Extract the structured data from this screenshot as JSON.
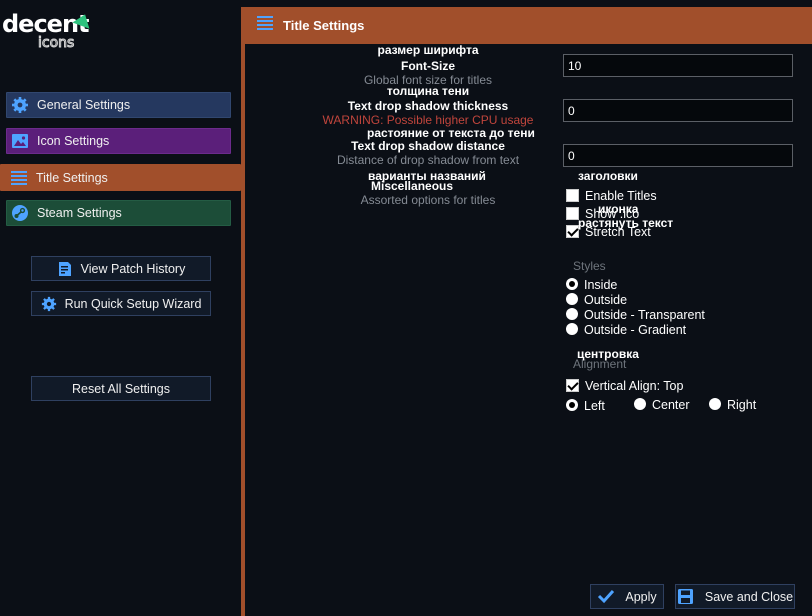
{
  "logo": {
    "line1": "decent",
    "line2": "icons"
  },
  "sidebar": {
    "items": [
      {
        "label": "General Settings",
        "icon": "gear-icon",
        "color": "#25385f"
      },
      {
        "label": "Icon Settings",
        "icon": "image-icon",
        "color": "#5b1f7a"
      },
      {
        "label": "Title Settings",
        "icon": "lines-icon",
        "color": "#a14f2b"
      },
      {
        "label": "Steam Settings",
        "icon": "steam-icon",
        "color": "#1c4d38"
      }
    ],
    "buttons": {
      "history": "View Patch History",
      "wizard": "Run Quick Setup Wizard",
      "reset": "Reset All Settings"
    }
  },
  "header": {
    "title": "Title Settings",
    "accent": "#a14f2b"
  },
  "settings": {
    "font_size": {
      "ru_label": "размер ширифта",
      "label": "Font-Size",
      "desc": "Global font size for titles",
      "value": "10"
    },
    "shadow_thickness": {
      "ru_label": "толщина тени",
      "label": "Text drop shadow thickness",
      "warning": "WARNING: Possible higher CPU usage",
      "value": "0"
    },
    "shadow_distance": {
      "ru_label": "растояние от текста до тени",
      "label": "Text drop shadow distance",
      "desc": "Distance of drop shadow from text",
      "value": "0"
    },
    "misc": {
      "ru_label": "варианты названий",
      "label": "Miscellaneous",
      "desc": "Assorted options for titles"
    }
  },
  "options": {
    "ru_titles": "заголовки",
    "ru_icon": "иконка",
    "ru_stretch": "растянуть текст",
    "enable_titles": {
      "label": "Enable Titles",
      "checked": false
    },
    "show_ico": {
      "label": "Show .ico",
      "checked": false
    },
    "stretch_text": {
      "label": "Stretch Text",
      "checked": true
    },
    "styles_label": "Styles",
    "styles": [
      {
        "label": "Inside",
        "selected": true
      },
      {
        "label": "Outside",
        "selected": false
      },
      {
        "label": "Outside - Transparent",
        "selected": false
      },
      {
        "label": "Outside - Gradient",
        "selected": false
      }
    ],
    "ru_alignment": "центровка",
    "alignment_label": "Alignment",
    "vertical_align": {
      "label": "Vertical Align: Top",
      "checked": true
    },
    "align": [
      {
        "label": "Left",
        "selected": true
      },
      {
        "label": "Center",
        "selected": false
      },
      {
        "label": "Right",
        "selected": false
      }
    ]
  },
  "footer": {
    "apply": "Apply",
    "save_close": "Save and Close"
  }
}
